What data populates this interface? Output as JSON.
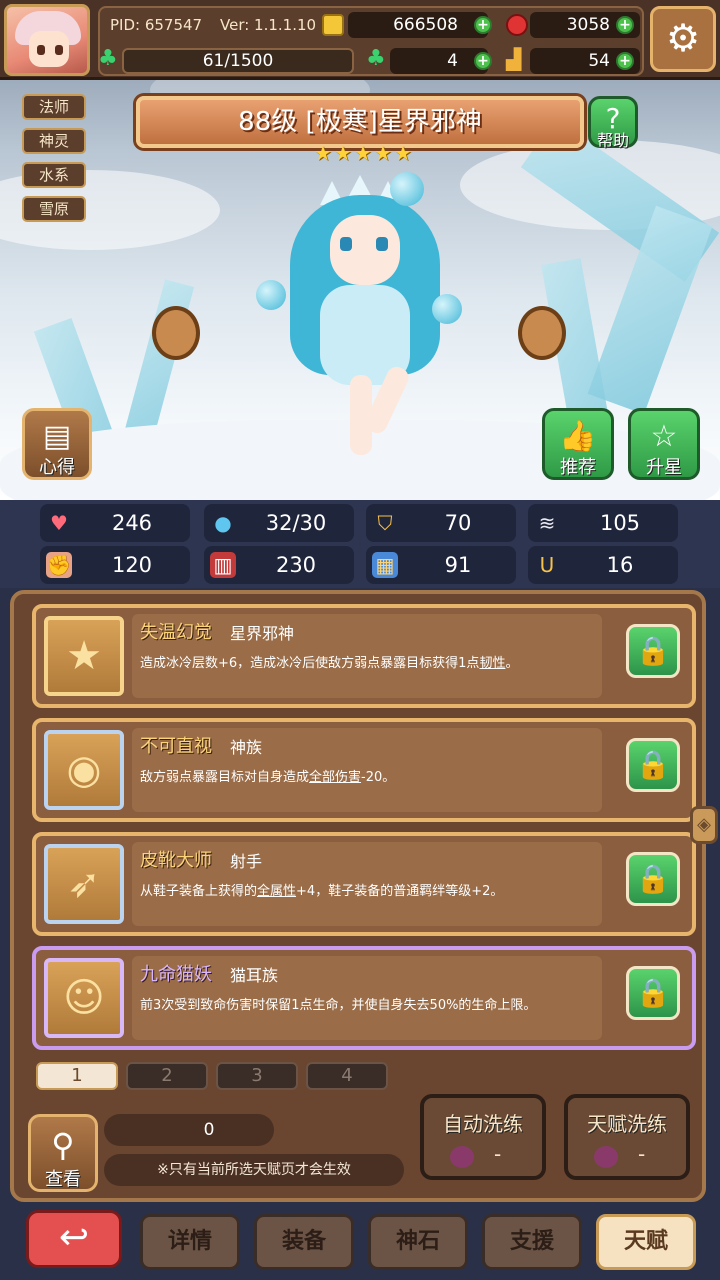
{
  "header": {
    "pid": "PID: 657547",
    "version": "Ver: 1.1.1.10",
    "gold": "666508",
    "gems": "3058",
    "exp": "61/1500",
    "clover": "4",
    "boots": "54"
  },
  "tags": [
    "法师",
    "神灵",
    "水系",
    "雪原"
  ],
  "hero": {
    "title": "88级 [极寒]星界邪神",
    "stars": 5,
    "help_label": "帮助",
    "notes_label": "心得",
    "recommend_label": "推荐",
    "upgrade_label": "升星"
  },
  "stats": [
    {
      "icon": "heart-icon",
      "value": "246"
    },
    {
      "icon": "water-drop-icon",
      "value": "32/30"
    },
    {
      "icon": "shield-icon",
      "value": "70"
    },
    {
      "icon": "wing-icon",
      "value": "105"
    },
    {
      "icon": "fist-icon",
      "value": "120"
    },
    {
      "icon": "book-icon",
      "value": "230"
    },
    {
      "icon": "scroll-icon",
      "value": "91"
    },
    {
      "icon": "horseshoe-icon",
      "value": "16"
    }
  ],
  "talents": [
    {
      "name": "失温幻觉",
      "type": "星界邪神",
      "desc_a": "造成冰冷层数+6，造成冰冷后使敌方弱点暴露目标获得1点",
      "desc_u": "韧性",
      "desc_b": "。"
    },
    {
      "name": "不可直视",
      "type": "神族",
      "desc_a": "敌方弱点暴露目标对自身造成",
      "desc_u": "全部伤害",
      "desc_b": "-20。"
    },
    {
      "name": "皮靴大师",
      "type": "射手",
      "desc_a": "从鞋子装备上获得的",
      "desc_u": "全属性",
      "desc_b": "+4，鞋子装备的普通羁绊等级+2。"
    },
    {
      "name": "九命猫妖",
      "type": "猫耳族",
      "desc_a": "前3次受到致命伤害时保留1点生命，并使自身失去50%的生命上限。",
      "desc_u": "",
      "desc_b": ""
    }
  ],
  "pages": [
    "1",
    "2",
    "3",
    "4"
  ],
  "bottom": {
    "cost": "0",
    "note": "※只有当前所选天赋页才会生效",
    "view_label": "查看",
    "auto_wash_label": "自动洗练",
    "auto_wash_cost": "-",
    "talent_wash_label": "天赋洗练",
    "talent_wash_cost": "-"
  },
  "nav": [
    "详情",
    "装备",
    "神石",
    "支援",
    "天赋"
  ],
  "colors": {
    "title_bg": "#c0703f",
    "lock_green": "#4cc24c",
    "card_border": "#e8b56c",
    "purple_border": "#c99cf0",
    "back_red": "#e45050"
  }
}
